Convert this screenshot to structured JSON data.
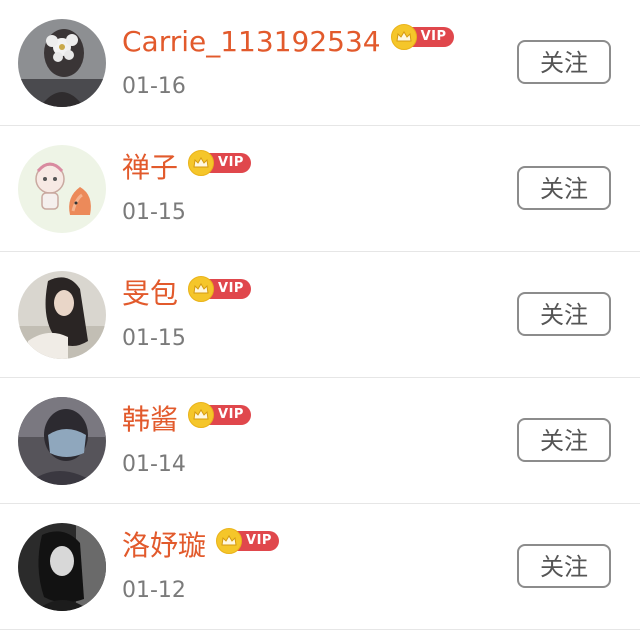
{
  "follower_list": [
    {
      "name": "Carrie_113192534",
      "vip_label": "VIP",
      "date": "01-16",
      "follow_label": "关注",
      "avatar_icon": "avatar-girl-flower"
    },
    {
      "name": "禅子",
      "vip_label": "VIP",
      "date": "01-15",
      "follow_label": "关注",
      "avatar_icon": "avatar-cartoon"
    },
    {
      "name": "旻包",
      "vip_label": "VIP",
      "date": "01-15",
      "follow_label": "关注",
      "avatar_icon": "avatar-girl-hair"
    },
    {
      "name": "韩酱",
      "vip_label": "VIP",
      "date": "01-14",
      "follow_label": "关注",
      "avatar_icon": "avatar-masked"
    },
    {
      "name": "洛妤璇",
      "vip_label": "VIP",
      "date": "01-12",
      "follow_label": "关注",
      "avatar_icon": "avatar-girl-bw"
    }
  ],
  "colors": {
    "name": "#e25a2c",
    "vip_badge": "#e0474c",
    "crown": "#f5c62a",
    "date": "#7a7a7a",
    "button_border": "#8c8c8c"
  }
}
